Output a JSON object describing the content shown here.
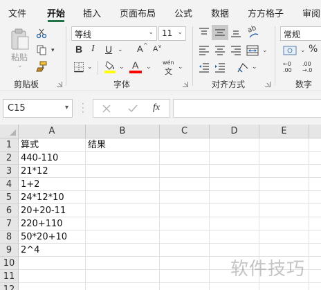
{
  "tabs": [
    "文件",
    "开始",
    "插入",
    "页面布局",
    "公式",
    "数据",
    "方方格子",
    "审阅"
  ],
  "ribbon": {
    "clipboard": {
      "paste_label": "粘贴",
      "group_label": "剪贴板"
    },
    "font": {
      "font_name": "等线",
      "font_size": "11",
      "bold": "B",
      "italic": "I",
      "underline": "U",
      "grow": "A",
      "shrink": "A",
      "color_a": "A",
      "phonetic": "wén",
      "phonetic_sub": "文",
      "group_label": "字体",
      "fill_color": "#ffff00",
      "font_color": "#ff0000"
    },
    "alignment": {
      "wrap_glyph": "ab",
      "group_label": "对齐方式"
    },
    "number": {
      "format": "常规",
      "group_label": "数字"
    }
  },
  "formula_bar": {
    "name_box": "C15",
    "fx": "fx",
    "formula": ""
  },
  "grid": {
    "columns": [
      "A",
      "B",
      "C",
      "D",
      "E"
    ],
    "rows": [
      {
        "n": "1",
        "A": "算式",
        "B": "结果"
      },
      {
        "n": "2",
        "A": "440-110",
        "B": ""
      },
      {
        "n": "3",
        "A": "21*12",
        "B": ""
      },
      {
        "n": "4",
        "A": "1+2",
        "B": ""
      },
      {
        "n": "5",
        "A": "24*12*10",
        "B": ""
      },
      {
        "n": "6",
        "A": "20+20-11",
        "B": ""
      },
      {
        "n": "7",
        "A": "220+110",
        "B": ""
      },
      {
        "n": "8",
        "A": "50*20+10",
        "B": ""
      },
      {
        "n": "9",
        "A": "2^4",
        "B": ""
      },
      {
        "n": "10",
        "A": "",
        "B": ""
      },
      {
        "n": "11",
        "A": "",
        "B": ""
      },
      {
        "n": "12",
        "A": "",
        "B": ""
      }
    ]
  },
  "watermark": "软件技巧"
}
